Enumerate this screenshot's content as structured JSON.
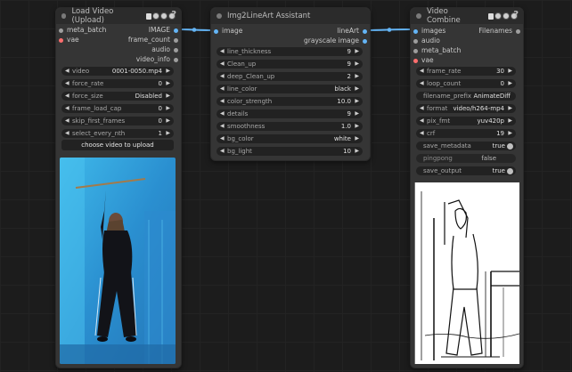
{
  "colors": {
    "image_socket": "#64b5f6",
    "vae_socket": "#ff6e6e",
    "generic_socket": "#9e9e9e",
    "link": "#64b5f6"
  },
  "load_video": {
    "title": "Load Video (Upload)",
    "inputs": [
      {
        "label": "meta_batch",
        "type": "generic"
      },
      {
        "label": "vae",
        "type": "vae"
      }
    ],
    "outputs": [
      {
        "label": "IMAGE",
        "type": "image"
      },
      {
        "label": "frame_count",
        "type": "generic"
      },
      {
        "label": "audio",
        "type": "generic"
      },
      {
        "label": "video_info",
        "type": "generic"
      }
    ],
    "widgets": [
      {
        "label": "video",
        "value": "0001-0050.mp4"
      },
      {
        "label": "force_rate",
        "value": "0"
      },
      {
        "label": "force_size",
        "value": "Disabled"
      },
      {
        "label": "frame_load_cap",
        "value": "0"
      },
      {
        "label": "skip_first_frames",
        "value": "0"
      },
      {
        "label": "select_every_nth",
        "value": "1"
      }
    ],
    "upload_button": "choose video to upload",
    "preview_icon": "video-preview-woman-dancing"
  },
  "lineart": {
    "title": "Img2LineArt Assistant",
    "inputs": [
      {
        "label": "image",
        "type": "image"
      }
    ],
    "outputs": [
      {
        "label": "lineArt",
        "type": "image"
      },
      {
        "label": "grayscale image",
        "type": "image"
      }
    ],
    "widgets": [
      {
        "label": "line_thickness",
        "value": "9"
      },
      {
        "label": "Clean_up",
        "value": "9"
      },
      {
        "label": "deep_Clean_up",
        "value": "2"
      },
      {
        "label": "line_color",
        "value": "black"
      },
      {
        "label": "color_strength",
        "value": "10.0"
      },
      {
        "label": "details",
        "value": "9"
      },
      {
        "label": "smoothness",
        "value": "1.0"
      },
      {
        "label": "bg_color",
        "value": "white"
      },
      {
        "label": "bg_light",
        "value": "10"
      }
    ]
  },
  "video_combine": {
    "title": "Video Combine",
    "inputs": [
      {
        "label": "images",
        "type": "image"
      },
      {
        "label": "audio",
        "type": "generic"
      },
      {
        "label": "meta_batch",
        "type": "generic"
      },
      {
        "label": "vae",
        "type": "vae"
      }
    ],
    "outputs": [
      {
        "label": "Filenames",
        "type": "generic"
      }
    ],
    "widgets": [
      {
        "label": "frame_rate",
        "value": "30",
        "kind": "number"
      },
      {
        "label": "loop_count",
        "value": "0",
        "kind": "number"
      },
      {
        "label": "filename_prefix",
        "value": "AnimateDiff",
        "kind": "text"
      },
      {
        "label": "format",
        "value": "video/h264-mp4",
        "kind": "combo"
      },
      {
        "label": "pix_fmt",
        "value": "yuv420p",
        "kind": "combo"
      },
      {
        "label": "crf",
        "value": "19",
        "kind": "number"
      },
      {
        "label": "save_metadata",
        "value": "true",
        "kind": "toggle"
      },
      {
        "label": "pingpong",
        "value": "false",
        "kind": "toggle"
      },
      {
        "label": "save_output",
        "value": "true",
        "kind": "toggle"
      }
    ],
    "preview_icon": "video-preview-lineart"
  }
}
